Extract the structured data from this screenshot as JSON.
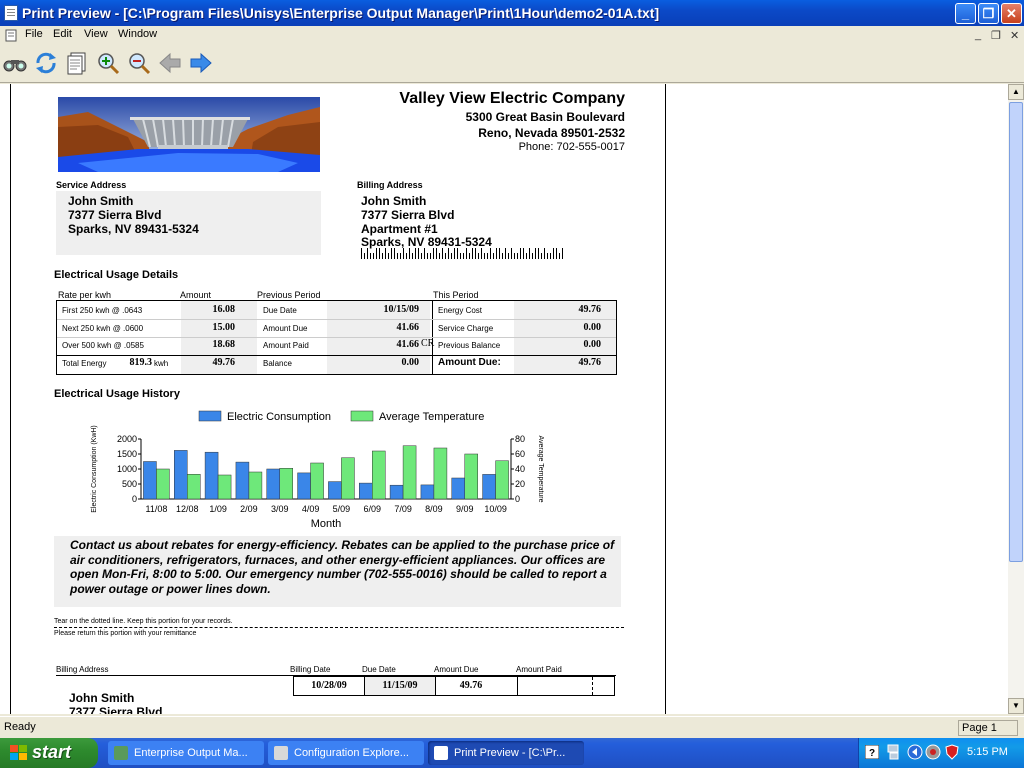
{
  "window": {
    "title": "Print Preview - [C:\\Program Files\\Unisys\\Enterprise Output Manager\\Print\\1Hour\\demo2-01A.txt]",
    "min_glyph": "_",
    "max_glyph": "❐",
    "close_glyph": "✕"
  },
  "menu": {
    "items": [
      "File",
      "Edit",
      "View",
      "Window"
    ],
    "mdi_min": "_",
    "mdi_restore": "❐",
    "mdi_close": "✕"
  },
  "toolbar": {
    "buttons": [
      "binoculars-icon",
      "refresh-icon",
      "pages-icon",
      "zoom-in-icon",
      "zoom-out-icon",
      "back-arrow-icon",
      "forward-arrow-icon"
    ]
  },
  "invoice": {
    "company": "Valley View Electric Company",
    "address1": "5300 Great Basin Boulevard",
    "address2": "Reno, Nevada 89501-2532",
    "phone": "Phone: 702-555-0017",
    "service_label": "Service Address",
    "service_lines": [
      "John Smith",
      "7377 Sierra Blvd",
      "Sparks, NV 89431-5324"
    ],
    "billing_label": "Billing Address",
    "billing_lines": [
      "John Smith",
      "7377 Sierra Blvd",
      "Apartment #1",
      "Sparks, NV 89431-5324"
    ],
    "usage_title": "Electrical Usage Details",
    "col_rate": "Rate per kwh",
    "col_amount": "Amount",
    "col_prev": "Previous Period",
    "col_this": "This Period",
    "rows": [
      {
        "rate": "First 250 kwh @ .0643",
        "amount": "16.08",
        "prev_label": "Due Date",
        "prev_val": "10/15/09",
        "this_label": "Energy Cost",
        "this_val": "49.76"
      },
      {
        "rate": "Next 250 kwh @ .0600",
        "amount": "15.00",
        "prev_label": "Amount Due",
        "prev_val": "41.66",
        "this_label": "Service Charge",
        "this_val": "0.00"
      },
      {
        "rate": "Over 500 kwh @ .0585",
        "amount": "18.68",
        "prev_label": "Amount Paid",
        "prev_val": "41.66",
        "this_label": "Previous Balance",
        "this_val": "0.00"
      },
      {
        "rate": "Total Energy",
        "amount": "49.76",
        "prev_label": "Balance",
        "prev_val": "0.00",
        "this_label": "Amount Due:",
        "this_val": "49.76"
      }
    ],
    "total_energy": "819.3",
    "kwh": "kwh",
    "cr": "CR",
    "history_title": "Electrical Usage History",
    "notice": "Contact us about rebates for energy-efficiency.  Rebates can be applied to the purchase price of air conditioners, refrigerators, furnaces, and other energy-efficient appliances.  Our offices are open Mon-Fri, 8:00 to 5:00. Our emergency number (702-555-0016) should be called to report a power outage or power lines down.",
    "tear_line1": "Tear on the dotted line.  Keep this portion for your records.",
    "tear_line2": "Please return this portion with your remittance",
    "remit_billing_label": "Billing Address",
    "remit_billing_date": "Billing Date",
    "remit_due_date": "Due Date",
    "remit_amount_due": "Amount Due",
    "remit_amount_paid": "Amount Paid",
    "remit_billing_date_val": "10/28/09",
    "remit_due_date_val": "11/15/09",
    "remit_amount_val": "49.76",
    "remit_name": "John Smith",
    "remit_street": "7377 Sierra Blvd"
  },
  "chart_data": {
    "type": "bar",
    "categories": [
      "11/08",
      "12/08",
      "1/09",
      "2/09",
      "3/09",
      "4/09",
      "5/09",
      "6/09",
      "7/09",
      "8/09",
      "9/09",
      "10/09"
    ],
    "series": [
      {
        "name": "Electric Consumption",
        "values": [
          1250,
          1620,
          1560,
          1230,
          1000,
          870,
          580,
          530,
          460,
          470,
          700,
          820
        ],
        "color": "#3a86e8",
        "axis": "left"
      },
      {
        "name": "Average Temperature",
        "values": [
          40,
          33,
          32,
          36,
          41,
          48,
          55,
          64,
          71,
          68,
          60,
          51
        ],
        "color": "#6ee87a",
        "axis": "right"
      }
    ],
    "xlabel": "Month",
    "ylabel_left": "Electric Consumption (KwH)",
    "ylabel_right": "Average Temperature",
    "ylim_left": [
      0,
      2000
    ],
    "ylim_right": [
      0,
      80
    ],
    "yticks_left": [
      "2000",
      "1500",
      "1000",
      "500",
      "0"
    ],
    "yticks_right": [
      "80",
      "60",
      "40",
      "20",
      "0"
    ],
    "legend": "top"
  },
  "status": {
    "left": "Ready",
    "right": "Page 1"
  },
  "taskbar": {
    "start": "start",
    "tasks": [
      "Enterprise Output Ma...",
      "Configuration Explore...",
      "Print Preview - [C:\\Pr..."
    ],
    "clock": "5:15 PM"
  }
}
